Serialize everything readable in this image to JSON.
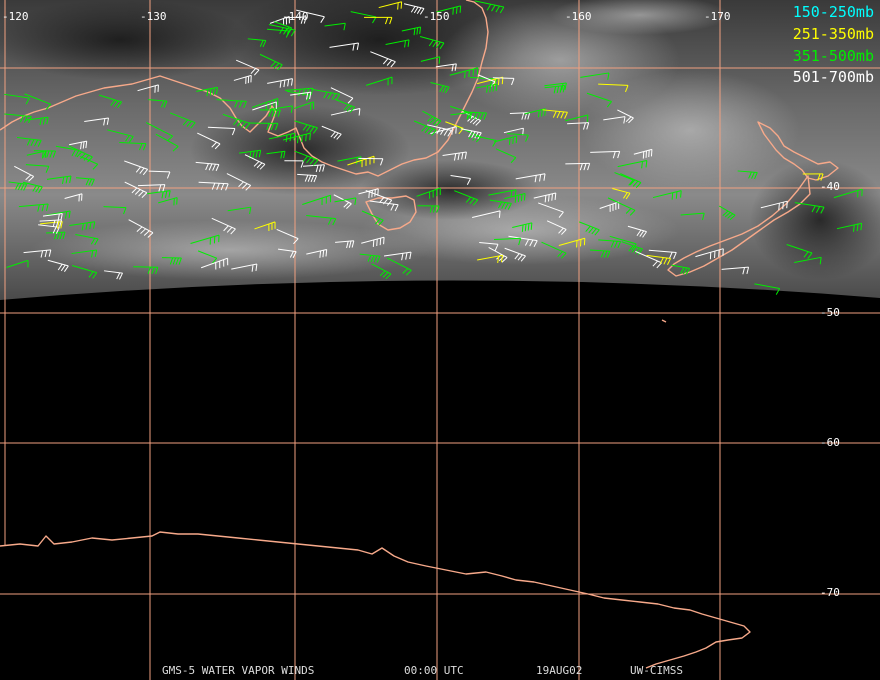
{
  "title": "GMS-5 WATER VAPOR WINDS",
  "time": "00:00 UTC",
  "date": "19AUG02",
  "source": "UW-CIMSS",
  "longitude_labels": [
    "-120",
    "-130",
    "-140",
    "-150",
    "-160",
    "-170"
  ],
  "latitude_labels": [
    "-40",
    "-50",
    "-60",
    "-70"
  ],
  "legend": [
    {
      "label": "150-250mb",
      "color": "#00ffff"
    },
    {
      "label": "251-350mb",
      "color": "#ffff00"
    },
    {
      "label": "351-500mb",
      "color": "#00ee00"
    },
    {
      "label": "501-700mb",
      "color": "#ffffff"
    }
  ],
  "colors": {
    "grid": "#f0a080",
    "coast": "#f7a98a",
    "background": "#000000"
  }
}
